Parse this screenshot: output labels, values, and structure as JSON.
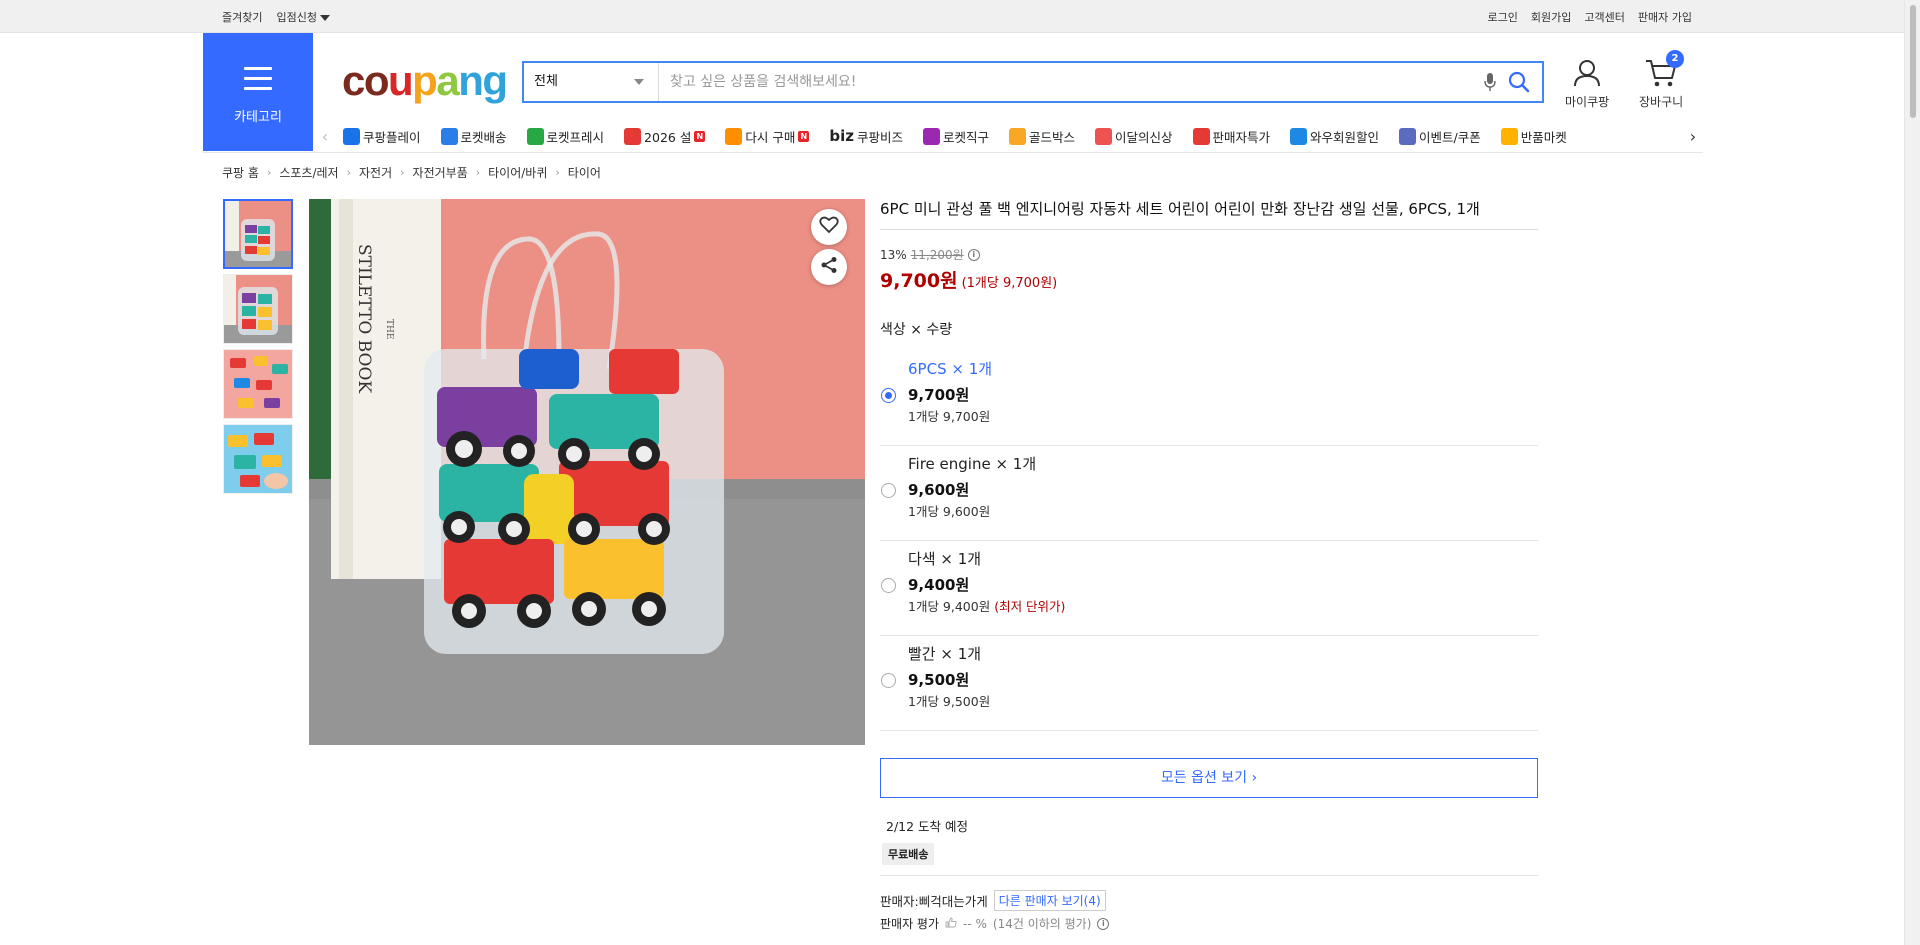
{
  "topbar": {
    "bookmark": "즐겨찾기",
    "vendor_apply": "입점신청",
    "login": "로그인",
    "signup": "회원가입",
    "customer_center": "고객센터",
    "seller_signup": "판매자 가입"
  },
  "header": {
    "category_label": "카테고리",
    "logo": "coupang",
    "search": {
      "category": "전체",
      "placeholder": "찾고 싶은 상품을 검색해보세요!"
    },
    "my_coupang": "마이쿠팡",
    "cart": "장바구니",
    "cart_count": "2"
  },
  "catnav": [
    {
      "label": "쿠팡플레이",
      "icon": "play-icon",
      "color": "#1a73e8"
    },
    {
      "label": "로켓배송",
      "icon": "rocket-icon",
      "color": "#2b7de9"
    },
    {
      "label": "로켓프레시",
      "icon": "rocket-fresh-icon",
      "color": "#28a745"
    },
    {
      "label": "2026 설",
      "icon": "gift-icon",
      "color": "#e53935",
      "badge": "N"
    },
    {
      "label": "다시 구매",
      "icon": "repurchase-icon",
      "color": "#ff8f00",
      "badge": "N"
    },
    {
      "label": "쿠팡비즈",
      "icon": "biz-icon",
      "color": "#222",
      "prefix": "biz"
    },
    {
      "label": "로켓직구",
      "icon": "global-icon",
      "color": "#9c27b0"
    },
    {
      "label": "골드박스",
      "icon": "goldbox-icon",
      "color": "#f9a825"
    },
    {
      "label": "이달의신상",
      "icon": "new-icon",
      "color": "#ef5350"
    },
    {
      "label": "판매자특가",
      "icon": "percent-icon",
      "color": "#e53935"
    },
    {
      "label": "와우회원할인",
      "icon": "wow-icon",
      "color": "#1e88e5"
    },
    {
      "label": "이벤트/쿠폰",
      "icon": "coupon-icon",
      "color": "#5c6bc0"
    },
    {
      "label": "반품마켓",
      "icon": "return-market-icon",
      "color": "#ffb300"
    }
  ],
  "breadcrumb": [
    "쿠팡 홈",
    "스포츠/레저",
    "자전거",
    "자전거부품",
    "타이어/바퀴",
    "타이어"
  ],
  "product": {
    "title": "6PC 미니 관성 풀 백 엔지니어링 자동차 세트 어린이 어린이 만화 장난감 생일 선물, 6PCS, 1개",
    "discount": "13%",
    "original_price": "11,200원",
    "price": "9,700원",
    "unit_price": "(1개당 9,700원)",
    "option_title": "색상 × 수량",
    "options": [
      {
        "name": "6PCS × 1개",
        "price": "9,700원",
        "unit": "1개당 9,700원",
        "note": "",
        "selected": true
      },
      {
        "name": "Fire engine × 1개",
        "price": "9,600원",
        "unit": "1개당 9,600원",
        "note": "",
        "selected": false
      },
      {
        "name": "다색 × 1개",
        "price": "9,400원",
        "unit": "1개당 9,400원",
        "note": "(최저 단위가)",
        "selected": false
      },
      {
        "name": "빨간 × 1개",
        "price": "9,500원",
        "unit": "1개당 9,500원",
        "note": "",
        "selected": false
      }
    ],
    "all_options_label": "모든 옵션 보기",
    "arrival": "2/12 도착 예정",
    "shipping_badge": "무료배송",
    "seller_label": "판매자:",
    "seller_name": "삐걱대는가게",
    "other_sellers": "다른 판매자 보기(4)",
    "seller_rating_label": "판매자 평가",
    "seller_rating_value": "-- %",
    "seller_rating_note": "(14건 이하의 평가)"
  },
  "colors": {
    "accent": "#346aff",
    "price_red": "#ae0000"
  }
}
